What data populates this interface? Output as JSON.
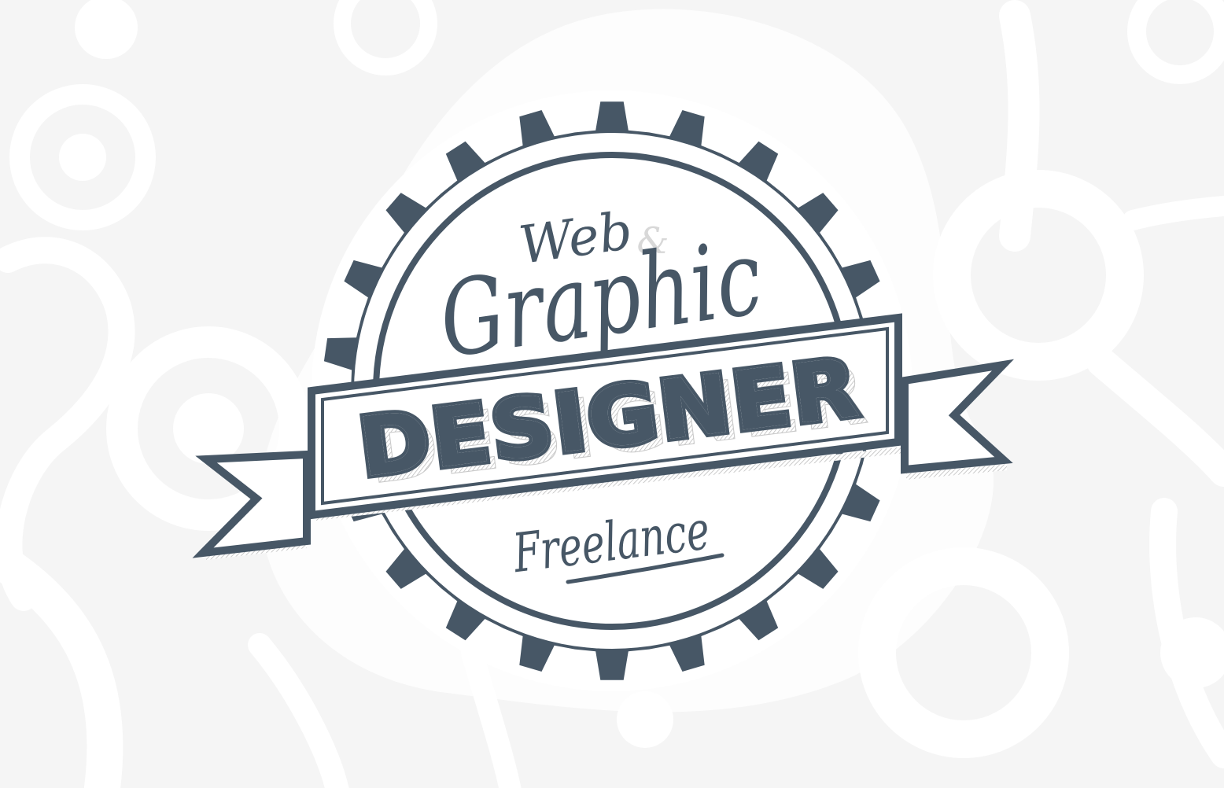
{
  "badge": {
    "line_web": "Web",
    "ampersand": "&",
    "line_graphic": "Graphic",
    "banner_text": "DESIGNER",
    "line_freelance": "Freelance"
  },
  "colors": {
    "background": "#f5f5f5",
    "background_gears": "#ffffff",
    "badge": "#475766",
    "badge_fill": "#ffffff",
    "ampersand": "#d8d8d8",
    "shadow_hatch": "#c9c9c9"
  },
  "icons": [
    "gear-icon",
    "ribbon-banner"
  ]
}
